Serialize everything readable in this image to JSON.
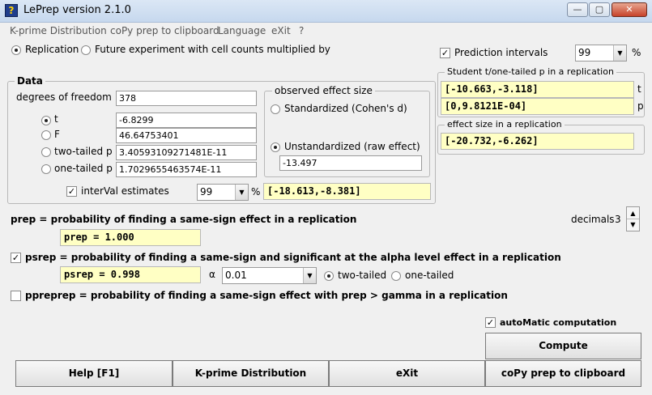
{
  "window": {
    "title": "LePrep version 2.1.0",
    "minimize_glyph": "—",
    "maximize_glyph": "▢",
    "close_glyph": "✕"
  },
  "menu": [
    "K-prime Distribution",
    "coPy prep to clipboard",
    "Language",
    "eXit",
    "?"
  ],
  "mode": {
    "replication_label": "Replication",
    "future_label": "Future experiment with cell counts multiplied by",
    "selected": "replication"
  },
  "prediction": {
    "label": "Prediction intervals",
    "checked": true,
    "level": "99",
    "percent": "%"
  },
  "student_group": {
    "title": "Student t/one-tailed p in a replication",
    "t_interval": "[-10.663,-3.118]",
    "t_suffix": "t",
    "p_interval": "[0,9.8121E-04]",
    "p_suffix": "p"
  },
  "effect_group": {
    "title": "effect size in a replication",
    "interval": "[-20.732,-6.262]"
  },
  "data": {
    "title": "Data",
    "df_label": "degrees of freedom",
    "df_value": "378",
    "stat_selected": "t",
    "t_label": "t",
    "t_value": "-6.8299",
    "f_label": "F",
    "f_value": "46.64753401",
    "two_tailed_label": "two-tailed p",
    "two_tailed_value": "3.40593109271481E-11",
    "one_tailed_label": "one-tailed p",
    "one_tailed_value": "1.7029655463574E-11",
    "interval_label": "interVal estimates",
    "interval_checked": true,
    "interval_level": "99",
    "interval_percent": "%",
    "interval_result": "[-18.613,-8.381]"
  },
  "observed": {
    "title": "observed effect size",
    "standardized_label": "Standardized (Cohen's d)",
    "unstandardized_label": "Unstandardized (raw effect)",
    "selected": "unstandardized",
    "raw_value": "-13.497"
  },
  "prep": {
    "label": "prep = probability of finding a same-sign effect in a replication",
    "result": "prep = 1.000",
    "decimals_label": "decimals",
    "decimals_value": "3"
  },
  "psrep": {
    "label": "psrep = probability of finding a same-sign and significant at the alpha level effect in a replication",
    "checked": true,
    "result": "psrep = 0.998",
    "alpha_symbol": "α",
    "alpha_value": "0.01",
    "two_tailed_label": "two-tailed",
    "one_tailed_label": "one-tailed",
    "tail_selected": "two-tailed"
  },
  "ppreprep": {
    "label": "ppreprep = probability of finding a same-sign effect with prep > gamma in a replication",
    "checked": false
  },
  "auto": {
    "label": "autoMatic computation",
    "checked": true
  },
  "buttons": {
    "compute": "Compute",
    "help": "Help [F1]",
    "kprime": "K-prime Distribution",
    "exit": "eXit",
    "copy": "coPy prep to clipboard"
  },
  "colors": {
    "result_bg": "#ffffc4",
    "window_bg": "#f0f0f0"
  }
}
